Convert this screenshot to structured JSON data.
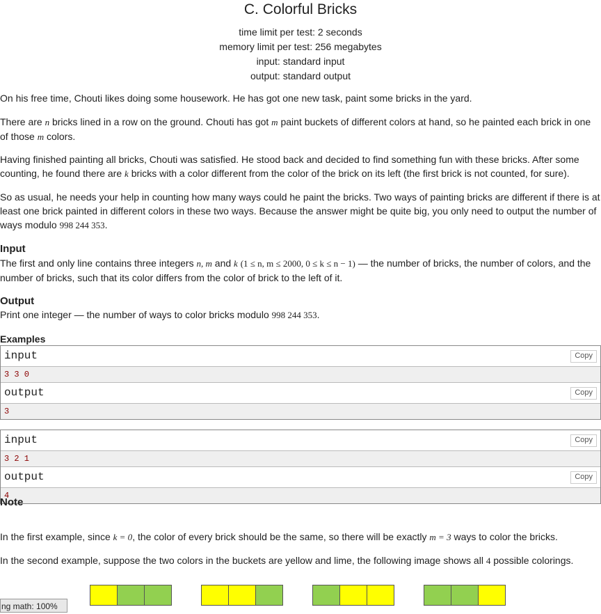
{
  "title": "C. Colorful Bricks",
  "limits": {
    "time": "time limit per test: 2 seconds",
    "memory": "memory limit per test: 256 megabytes",
    "input": "input: standard input",
    "output": "output: standard output"
  },
  "statement": {
    "p1": "On his free time, Chouti likes doing some housework. He has got one new task, paint some bricks in the yard.",
    "p2a": "There are ",
    "p2_n": "n",
    "p2b": " bricks lined in a row on the ground. Chouti has got ",
    "p2_m": "m",
    "p2c": " paint buckets of different colors at hand, so he painted each brick in one of those ",
    "p2_m2": "m",
    "p2d": " colors.",
    "p3a": "Having finished painting all bricks, Chouti was satisfied. He stood back and decided to find something fun with these bricks. After some counting, he found there are ",
    "p3_k": "k",
    "p3b": " bricks with a color different from the color of the brick on its left (the first brick is not counted, for sure).",
    "p4a": "So as usual, he needs your help in counting how many ways could he paint the bricks. Two ways of painting bricks are different if there is at least one brick painted in different colors in these two ways. Because the answer might be quite big, you only need to output the number of ways modulo ",
    "p4_mod": "998 244 353",
    "p4b": "."
  },
  "input_section": {
    "heading": "Input",
    "t1": "The first and only line contains three integers ",
    "vars": "n, m",
    "t2": " and ",
    "k": "k",
    "constraint": "(1 ≤ n, m ≤ 2000, 0 ≤ k ≤ n − 1)",
    "t3": " — the number of bricks, the number of colors, and the number of bricks, such that its color differs from the color of brick to the left of it."
  },
  "output_section": {
    "heading": "Output",
    "t1": "Print one integer — the number of ways to color bricks modulo ",
    "mod": "998 244 353",
    "t2": "."
  },
  "examples": {
    "heading": "Examples",
    "input_label": "input",
    "output_label": "output",
    "copy_label": "Copy",
    "items": [
      {
        "input": "3 3 0",
        "output": "3"
      },
      {
        "input": "3 2 1",
        "output": "4"
      }
    ]
  },
  "note": {
    "heading": "Note",
    "p1a": "In the first example, since ",
    "p1_k": "k = 0",
    "p1b": ", the color of every brick should be the same, so there will be exactly ",
    "p1_m": "m = 3",
    "p1c": " ways to color the bricks.",
    "p2a": "In the second example, suppose the two colors in the buckets are yellow and lime, the following image shows all ",
    "p2_num": "4",
    "p2b": " possible colorings."
  },
  "colorings": {
    "colors": {
      "yellow": "#ffff00",
      "lime": "#92d050"
    },
    "sets": [
      [
        "yellow",
        "lime",
        "lime"
      ],
      [
        "yellow",
        "yellow",
        "lime"
      ],
      [
        "lime",
        "yellow",
        "yellow"
      ],
      [
        "lime",
        "lime",
        "yellow"
      ]
    ]
  },
  "status_bar": "ng math: 100%"
}
